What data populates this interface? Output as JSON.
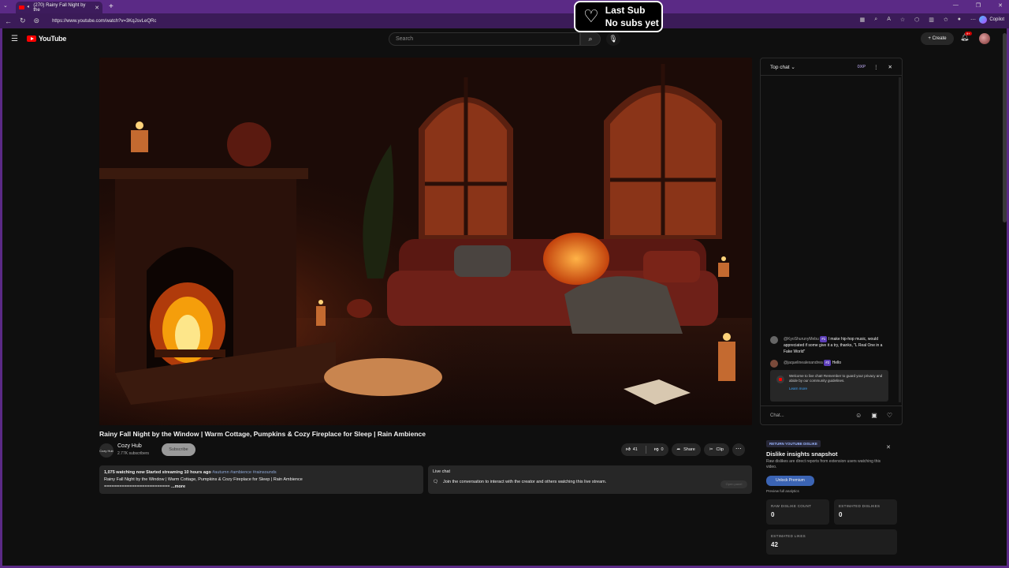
{
  "browser": {
    "tab_title": "(270) Rainy Fall Night by the",
    "url": "https://www.youtube.com/watch?v=3KqJsvLeQRc",
    "copilot_label": "Copilot"
  },
  "overlay": {
    "line1": "Last Sub",
    "line2": "No subs yet"
  },
  "header": {
    "logo_text": "YouTube",
    "search_placeholder": "Search",
    "create_label": "Create",
    "notification_count": "9+"
  },
  "video": {
    "title": "Rainy Fall Night by the Window | Warm Cottage, Pumpkins & Cozy Fireplace for Sleep | Rain Ambience",
    "channel_name": "Cozy Hub",
    "channel_avatar_text": "Cozy Hub",
    "channel_subs": "2.77K subscribers",
    "subscribe_label": "Subscribe",
    "likes": "41",
    "dislikes": "0",
    "share_label": "Share",
    "clip_label": "Clip"
  },
  "description": {
    "stats": "1,075 watching now  Started streaming 10 hours ago",
    "tags": "#autumn #ambience #rainsounds",
    "text": "Rainy Fall Night by the Window | Warm Cottage, Pumpkins & Cozy Fireplace for Sleep | Rain Ambience",
    "separator": "==========================",
    "more_label": "...more"
  },
  "live_chat_box": {
    "title": "Live chat",
    "text": "Join the conversation to interact with the creator and others watching this live stream.",
    "open_label": "Open panel"
  },
  "chat": {
    "filter_label": "Top chat",
    "xp_label": "0XP",
    "messages": [
      {
        "author": "@KyoShurunyMebu",
        "badge": "#1",
        "text": "I make hip-hop music, would appreciated if some give it a try, thanks, \"L Real One in a Fake World\""
      },
      {
        "author": "@jaquelinealexandrea",
        "badge": "#2",
        "text": "Hello"
      }
    ],
    "welcome_text": "Welcome to live chat! Remember to guard your privacy and abide by our community guidelines.",
    "learn_more": "Learn more",
    "input_placeholder": "Chat..."
  },
  "dislike_card": {
    "tag": "RETURN YOUTUBE DISLIKE",
    "title": "Dislike insights snapshot",
    "description": "Raw dislikes are direct reports from extension users watching this video.",
    "button_label": "Unlock Premium",
    "preview_label": "Preview full analytics",
    "raw_label": "RAW DISLIKE COUNT",
    "raw_value": "0",
    "est_dislikes_label": "ESTIMATED DISLIKES",
    "est_dislikes_value": "0",
    "est_likes_label": "ESTIMATED LIKES",
    "est_likes_value": "42"
  },
  "colors": {
    "browser_accent": "#5b2a86",
    "yt_red": "#ff0000",
    "link_blue": "#3ea6ff",
    "premium_blue": "#3b64b4"
  }
}
